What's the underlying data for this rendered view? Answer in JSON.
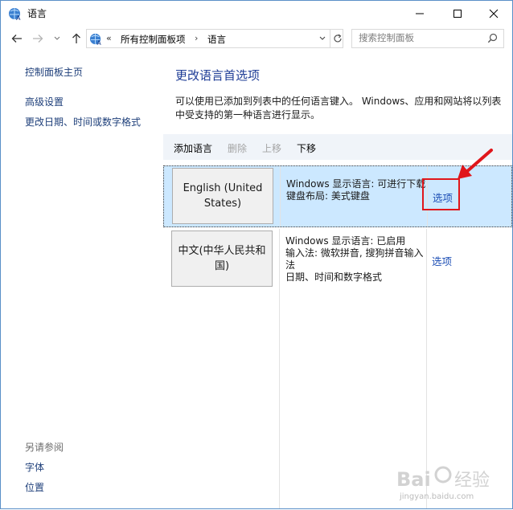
{
  "window": {
    "title": "语言"
  },
  "nav": {
    "crumb_sep": "«",
    "crumb1": "所有控制面板项",
    "crumb_arrow": "›",
    "crumb2": "语言",
    "search_placeholder": "搜索控制面板"
  },
  "sidebar": {
    "home": "控制面板主页",
    "advanced": "高级设置",
    "datetime": "更改日期、时间或数字格式",
    "see_also": "另请参阅",
    "fonts": "字体",
    "location": "位置"
  },
  "main": {
    "heading": "更改语言首选项",
    "description": "可以使用已添加到列表中的任何语言键入。 Windows、应用和网站将以列表中受支持的第一种语言进行显示。"
  },
  "toolbar": {
    "add": "添加语言",
    "remove": "删除",
    "up": "上移",
    "down": "下移"
  },
  "languages": [
    {
      "name": "English (United States)",
      "info": [
        "Windows 显示语言: 可进行下载",
        "键盘布局: 美式键盘"
      ],
      "options": "选项",
      "selected": true
    },
    {
      "name": "中文(中华人民共和国)",
      "info": [
        "Windows 显示语言: 已启用",
        "输入法: 微软拼音, 搜狗拼音输入法",
        "日期、时间和数字格式"
      ],
      "options": "选项",
      "selected": false
    }
  ],
  "watermark": {
    "brand": "Baidu 经验",
    "url": "jingyan.baidu.com"
  },
  "colors": {
    "link": "#1e3f7a",
    "heading": "#1e3c96",
    "selected_row": "#cce8ff",
    "annotation_red": "#e0161b"
  }
}
